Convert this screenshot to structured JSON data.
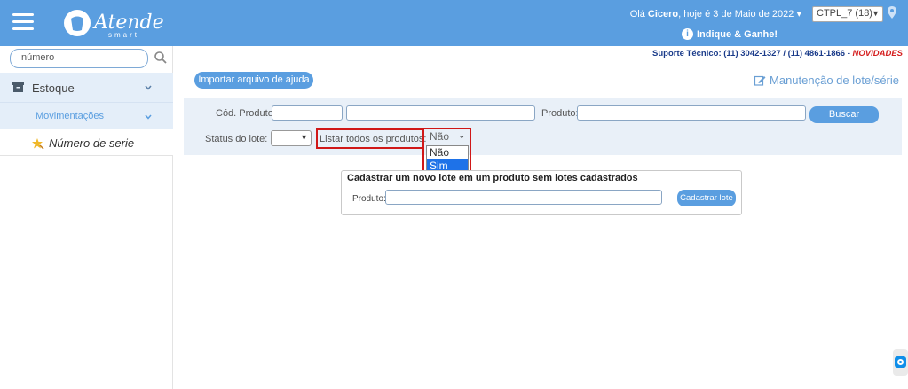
{
  "header": {
    "greeting_prefix": "Olá",
    "user_name": "Cicero",
    "greeting_date": ", hoje é 3 de Maio de 2022",
    "company_selected": "CTPL_7 (18)",
    "indique_label": "Indique & Ganhe!",
    "logo_text": "Atende",
    "logo_subtext": "smart"
  },
  "sidebar": {
    "search_value": "número",
    "items": [
      {
        "label": "Estoque"
      },
      {
        "label": "Movimentações"
      },
      {
        "label": "Número de serie"
      }
    ]
  },
  "support": {
    "text": "Suporte Técnico: (11) 3042-1327 / (11) 4861-1866 - ",
    "novidades": "NOVIDADES"
  },
  "main": {
    "import_button": "Importar arquivo de ajuda",
    "page_title": "Manutenção de lote/série",
    "filters": {
      "cod_produto_label": "Cód. Produto:",
      "produto_label": "Produto:",
      "buscar_button": "Buscar",
      "status_label": "Status do lote:",
      "listar_label": "Listar todos os produtos:",
      "listar_selected": "Não",
      "listar_options": [
        "Não",
        "Sim"
      ]
    },
    "register": {
      "title": "Cadastrar um novo lote em um produto sem lotes cadastrados",
      "produto_label": "Produto:",
      "button": "Cadastrar lote"
    }
  },
  "colors": {
    "brand": "#5a9ee0",
    "highlight": "#d01818",
    "selected_option": "#1e72e8"
  }
}
